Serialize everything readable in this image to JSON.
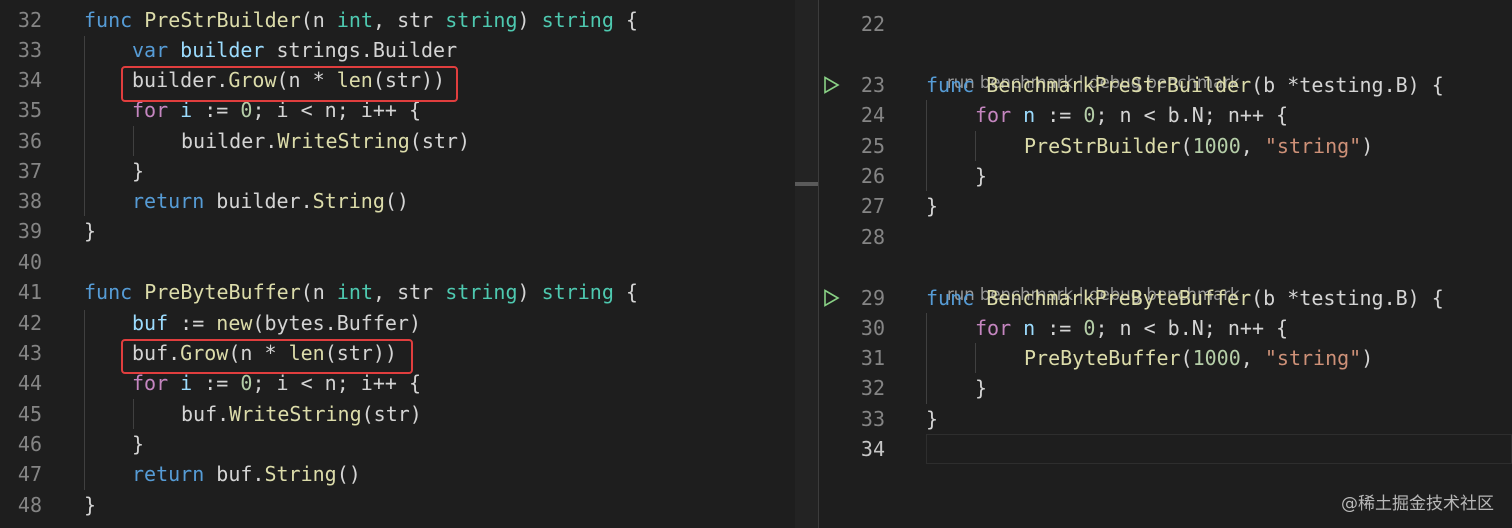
{
  "left_editor": {
    "lines": [
      {
        "n": "32",
        "t": "func PreStrBuilder(n int, str string) string {"
      },
      {
        "n": "33",
        "t": "var builder strings.Builder"
      },
      {
        "n": "34",
        "t": "builder.Grow(n * len(str))"
      },
      {
        "n": "35",
        "t": "for i := 0; i < n; i++ {"
      },
      {
        "n": "36",
        "t": "builder.WriteString(str)"
      },
      {
        "n": "37",
        "t": "}"
      },
      {
        "n": "38",
        "t": "return builder.String()"
      },
      {
        "n": "39",
        "t": "}"
      },
      {
        "n": "40",
        "t": ""
      },
      {
        "n": "41",
        "t": "func PreByteBuffer(n int, str string) string {"
      },
      {
        "n": "42",
        "t": "buf := new(bytes.Buffer)"
      },
      {
        "n": "43",
        "t": "buf.Grow(n * len(str))"
      },
      {
        "n": "44",
        "t": "for i := 0; i < n; i++ {"
      },
      {
        "n": "45",
        "t": "buf.WriteString(str)"
      },
      {
        "n": "46",
        "t": "}"
      },
      {
        "n": "47",
        "t": "return buf.String()"
      },
      {
        "n": "48",
        "t": "}"
      }
    ]
  },
  "right_editor": {
    "lines": [
      {
        "n": "22",
        "t": ""
      },
      {
        "n": "23",
        "t": "func BenchmarkPreStrBuilder(b *testing.B) {"
      },
      {
        "n": "24",
        "t": "for n := 0; n < b.N; n++ {"
      },
      {
        "n": "25",
        "t": "PreStrBuilder(1000, \"string\")"
      },
      {
        "n": "26",
        "t": "}"
      },
      {
        "n": "27",
        "t": "}"
      },
      {
        "n": "28",
        "t": ""
      },
      {
        "n": "29",
        "t": "func BenchmarkPreByteBuffer(b *testing.B) {"
      },
      {
        "n": "30",
        "t": "for n := 0; n < b.N; n++ {"
      },
      {
        "n": "31",
        "t": "PreByteBuffer(1000, \"string\")"
      },
      {
        "n": "32",
        "t": "}"
      },
      {
        "n": "33",
        "t": "}"
      },
      {
        "n": "34",
        "t": ""
      }
    ],
    "code_lenses": [
      {
        "run": "run benchmark",
        "sep": " | ",
        "debug": "debug benchmark"
      },
      {
        "run": "run benchmark",
        "sep": " | ",
        "debug": "debug benchmark"
      }
    ]
  },
  "icons": {
    "run_gutter": "run-triangle-icon"
  },
  "colors": {
    "highlight_border": "#e03e3e",
    "keyword": "#569cd6",
    "control": "#c586c0",
    "function": "#dcdcaa",
    "type": "#4ec9b0"
  },
  "watermark": "@稀土掘金技术社区"
}
